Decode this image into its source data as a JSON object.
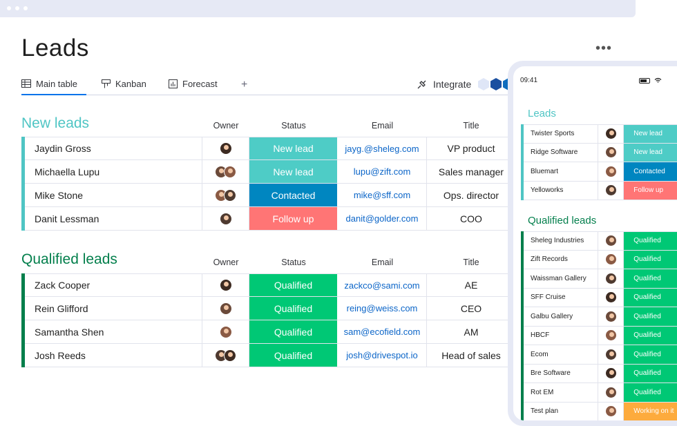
{
  "window": {
    "title": "Leads"
  },
  "tabs": [
    {
      "label": "Main table",
      "icon": "table-icon",
      "active": true
    },
    {
      "label": "Kanban",
      "icon": "kanban-icon",
      "active": false
    },
    {
      "label": "Forecast",
      "icon": "chart-icon",
      "active": false
    }
  ],
  "tab_add": "+",
  "more_menu": "•••",
  "integrate": {
    "label": "Integrate",
    "icon": "integrate-icon"
  },
  "colors": {
    "new_leads": "#4fc5c4",
    "qualified_leads": "#037f4c",
    "status_new_lead": "#4eccc6",
    "status_contacted": "#0086c0",
    "status_follow_up": "#ff7575",
    "status_qualified": "#00c875",
    "status_working_on_it": "#fdab3d",
    "accent": "#0073ea"
  },
  "columns": {
    "owner": "Owner",
    "status": "Status",
    "email": "Email",
    "title": "Title"
  },
  "groups": [
    {
      "title": "New leads",
      "color": "#4fc5c4",
      "rows": [
        {
          "name": "Jaydin Gross",
          "owners": 1,
          "status": "New lead",
          "status_color": "#4eccc6",
          "email": "jayg.@sheleg.com",
          "title": "VP product"
        },
        {
          "name": "Michaella Lupu",
          "owners": 2,
          "status": "New lead",
          "status_color": "#4eccc6",
          "email": "lupu@zift.com",
          "title": "Sales manager"
        },
        {
          "name": "Mike Stone",
          "owners": 2,
          "status": "Contacted",
          "status_color": "#0086c0",
          "email": "mike@sff.com",
          "title": "Ops. director"
        },
        {
          "name": "Danit Lessman",
          "owners": 1,
          "status": "Follow up",
          "status_color": "#ff7575",
          "email": "danit@golder.com",
          "title": "COO"
        }
      ]
    },
    {
      "title": "Qualified leads",
      "color": "#037f4c",
      "rows": [
        {
          "name": "Zack Cooper",
          "owners": 1,
          "status": "Qualified",
          "status_color": "#00c875",
          "email": "zackco@sami.com",
          "title": "AE"
        },
        {
          "name": "Rein Glifford",
          "owners": 1,
          "status": "Qualified",
          "status_color": "#00c875",
          "email": "reing@weiss.com",
          "title": "CEO"
        },
        {
          "name": "Samantha Shen",
          "owners": 1,
          "status": "Qualified",
          "status_color": "#00c875",
          "email": "sam@ecofield.com",
          "title": "AM"
        },
        {
          "name": "Josh Reeds",
          "owners": 2,
          "status": "Qualified",
          "status_color": "#00c875",
          "email": "josh@drivespot.io",
          "title": "Head of sales"
        }
      ]
    }
  ],
  "phone": {
    "time": "09:41",
    "groups": [
      {
        "title": "Leads",
        "color": "#4fc5c4",
        "rows": [
          {
            "name": "Twister Sports",
            "status": "New lead",
            "status_color": "#4eccc6"
          },
          {
            "name": "Ridge Software",
            "status": "New lead",
            "status_color": "#4eccc6"
          },
          {
            "name": "Bluemart",
            "status": "Contacted",
            "status_color": "#0086c0"
          },
          {
            "name": "Yelloworks",
            "status": "Follow up",
            "status_color": "#ff7575"
          }
        ]
      },
      {
        "title": "Qualified leads",
        "color": "#037f4c",
        "rows": [
          {
            "name": "Sheleg Industries",
            "status": "Qualified",
            "status_color": "#00c875"
          },
          {
            "name": "Zift Records",
            "status": "Qualified",
            "status_color": "#00c875"
          },
          {
            "name": "Waissman Gallery",
            "status": "Qualified",
            "status_color": "#00c875"
          },
          {
            "name": "SFF Cruise",
            "status": "Qualified",
            "status_color": "#00c875"
          },
          {
            "name": "Galbu Gallery",
            "status": "Qualified",
            "status_color": "#00c875"
          },
          {
            "name": "HBCF",
            "status": "Qualified",
            "status_color": "#00c875"
          },
          {
            "name": "Ecom",
            "status": "Qualified",
            "status_color": "#00c875"
          },
          {
            "name": "Bre Software",
            "status": "Qualified",
            "status_color": "#00c875"
          },
          {
            "name": "Rot EM",
            "status": "Qualified",
            "status_color": "#00c875"
          },
          {
            "name": "Test plan",
            "status": "Working on it",
            "status_color": "#fdab3d"
          }
        ]
      }
    ]
  }
}
